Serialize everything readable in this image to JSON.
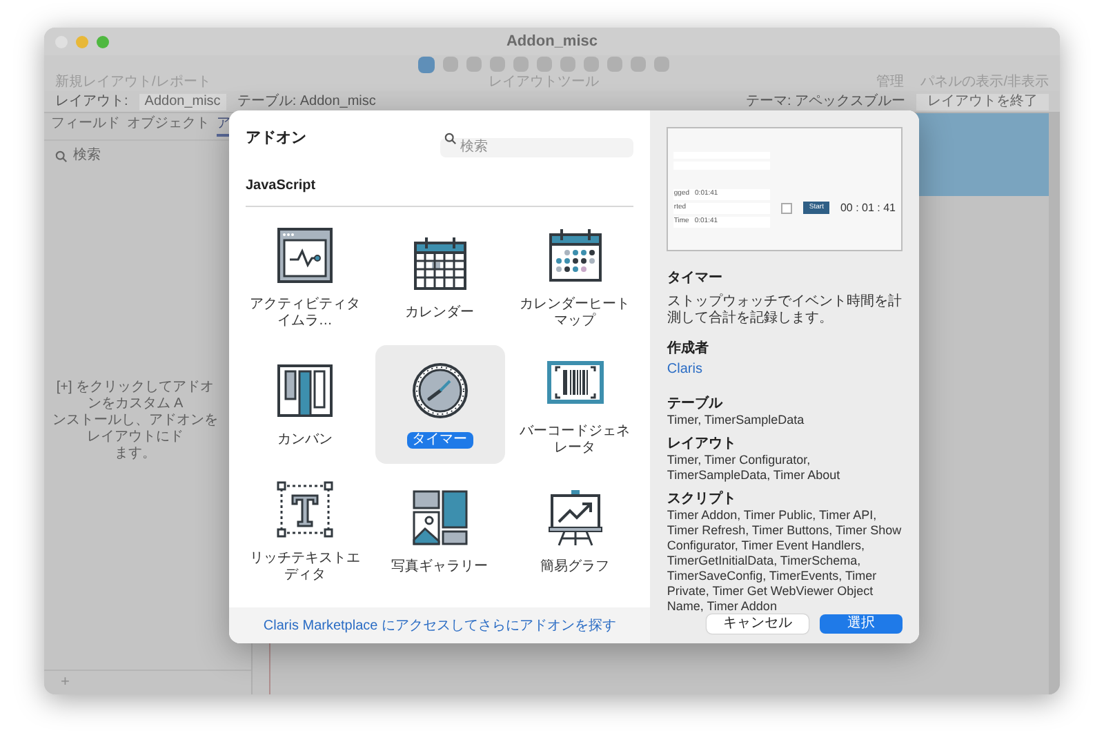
{
  "window": {
    "title": "Addon_misc"
  },
  "toolbar": {
    "groups": [
      {
        "label": "新規レイアウト/レポート"
      },
      {
        "label": "レイアウトツール"
      },
      {
        "label": "管理"
      },
      {
        "label": "パネルの表示/非表示"
      }
    ]
  },
  "layout_bar": {
    "layout_label": "レイアウト:",
    "layout_value": "Addon_misc",
    "table": "テーブル: Addon_misc",
    "theme": "テーマ: アペックスブルー",
    "exit_button": "レイアウトを終了"
  },
  "sidebar": {
    "tabs": [
      {
        "label": "フィールド",
        "selected": false
      },
      {
        "label": "オブジェクト",
        "selected": false
      },
      {
        "label": "ア",
        "selected": true
      }
    ],
    "search_placeholder": "検索",
    "hint_lines": [
      "[+] をクリックしてアドオンをカスタム A",
      "ンストールし、アドオンをレイアウトにド",
      "ます。"
    ],
    "add_button": "+"
  },
  "dialog": {
    "title": "アドオン",
    "search_placeholder": "検索",
    "section": "JavaScript",
    "addons": [
      {
        "label": "アクティビティタイムラ…",
        "kind": "activity",
        "selected": false
      },
      {
        "label": "カレンダー",
        "kind": "calendar",
        "selected": false
      },
      {
        "label": "カレンダーヒートマップ",
        "kind": "heatmap",
        "selected": false
      },
      {
        "label": "カンバン",
        "kind": "kanban",
        "selected": false
      },
      {
        "label": "タイマー",
        "kind": "timer",
        "selected": true
      },
      {
        "label": "バーコードジェネレータ",
        "kind": "barcode",
        "selected": false
      },
      {
        "label": "リッチテキストエディタ",
        "kind": "richtext",
        "selected": false
      },
      {
        "label": "写真ギャラリー",
        "kind": "gallery",
        "selected": false
      },
      {
        "label": "簡易グラフ",
        "kind": "chart",
        "selected": false
      }
    ],
    "footer_link": "Claris Marketplace にアクセスしてさらにアドオンを探す",
    "preview": {
      "rows": [
        {
          "label": "gged",
          "value": "0:01:41"
        },
        {
          "label": "rted"
        },
        {
          "label": "Time",
          "value": "0:01:41"
        }
      ],
      "start_button": "Start",
      "clock": "00 : 01 : 41"
    },
    "detail": {
      "name": "タイマー",
      "description": "ストップウォッチでイベント時間を計測して合計を記録します。",
      "author_heading": "作成者",
      "author": "Claris",
      "sections": [
        {
          "heading": "テーブル",
          "text": "Timer, TimerSampleData"
        },
        {
          "heading": "レイアウト",
          "text": "Timer, Timer Configurator, TimerSampleData, Timer About"
        },
        {
          "heading": "スクリプト",
          "text": "Timer Addon, Timer Public, Timer API, Timer Refresh, Timer Buttons, Timer Show Configurator, Timer Event Handlers, TimerGetInitialData, TimerSchema, TimerSaveConfig, TimerEvents, Timer Private, Timer Get WebViewer Object Name, Timer Addon"
        }
      ]
    },
    "buttons": {
      "cancel": "キャンセル",
      "ok": "選択"
    }
  }
}
